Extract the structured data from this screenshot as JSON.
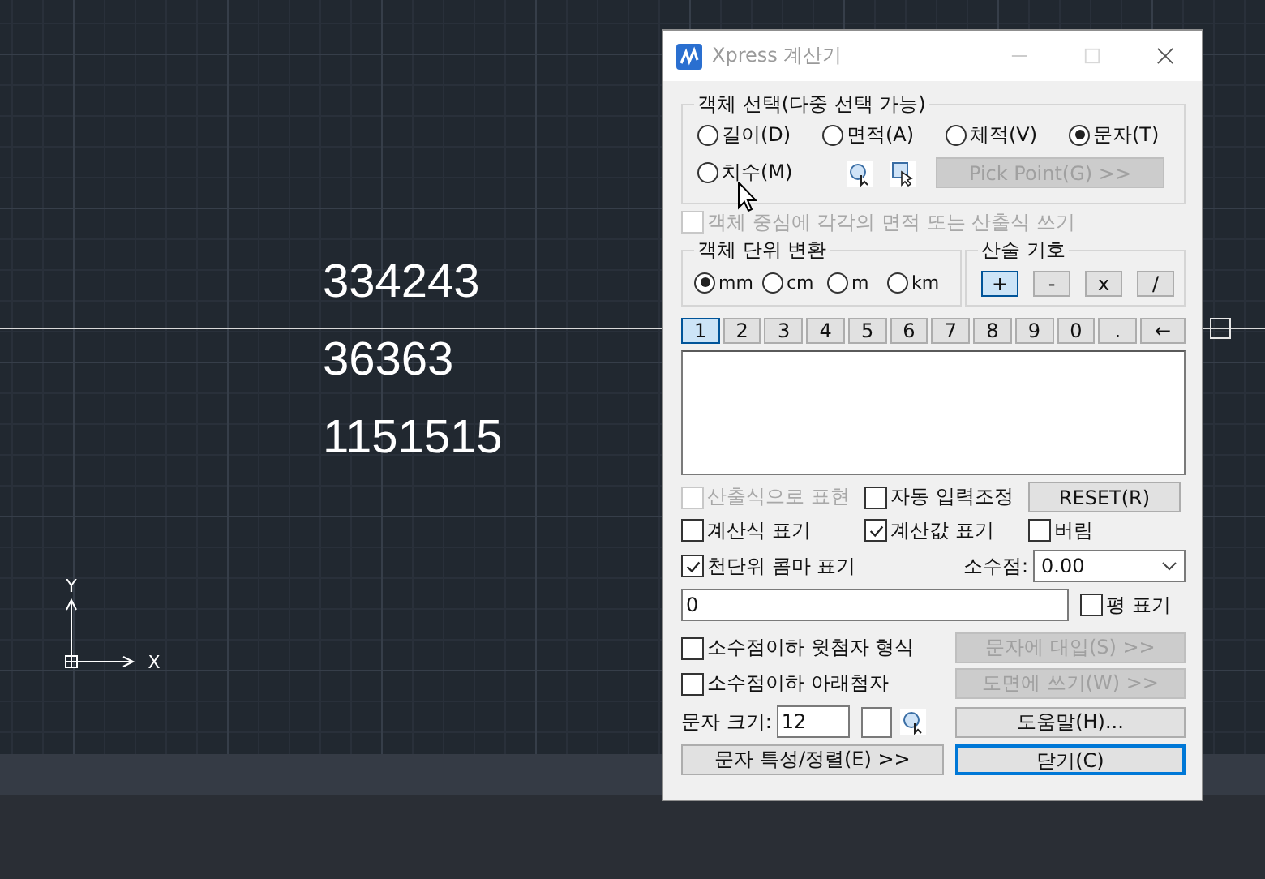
{
  "canvas": {
    "texts": [
      "334243",
      "36363",
      "1151515"
    ],
    "axis_labels": [
      "Y",
      "X"
    ]
  },
  "window": {
    "title": "Xpress 계산기"
  },
  "object_selection": {
    "title": "객체 선택(다중 선택 가능)",
    "options": [
      {
        "label": "길이(D)",
        "selected": false
      },
      {
        "label": "면적(A)",
        "selected": false
      },
      {
        "label": "체적(V)",
        "selected": false
      },
      {
        "label": "문자(T)",
        "selected": true
      },
      {
        "label": "치수(M)",
        "selected": false
      }
    ]
  },
  "unit_conversion": {
    "title": "객체 단위 변환",
    "units": [
      {
        "label": "mm",
        "selected": true
      },
      {
        "label": "cm",
        "selected": false
      },
      {
        "label": "m",
        "selected": false
      },
      {
        "label": "km",
        "selected": false
      }
    ]
  },
  "operators": {
    "title": "산술 기호",
    "buttons": [
      {
        "label": "+",
        "selected": true
      },
      {
        "label": "-",
        "selected": false
      },
      {
        "label": "x",
        "selected": false
      },
      {
        "label": "/",
        "selected": false
      }
    ]
  },
  "keypad": [
    {
      "label": "1",
      "selected": true
    },
    {
      "label": "2",
      "selected": false
    },
    {
      "label": "3",
      "selected": false
    },
    {
      "label": "4",
      "selected": false
    },
    {
      "label": "5",
      "selected": false
    },
    {
      "label": "6",
      "selected": false
    },
    {
      "label": "7",
      "selected": false
    },
    {
      "label": "8",
      "selected": false
    },
    {
      "label": "9",
      "selected": false
    },
    {
      "label": "0",
      "selected": false
    },
    {
      "label": ".",
      "selected": false
    },
    {
      "label": "←",
      "selected": false
    }
  ],
  "checks": [
    {
      "label": "객체 중심에 각각의 면적 또는 산출식 쓰기",
      "checked": false,
      "disabled": true
    },
    {
      "label": "산출식으로 표현",
      "checked": false,
      "disabled": true
    },
    {
      "label": "자동 입력조정",
      "checked": false,
      "disabled": false
    },
    {
      "label": "계산식 표기",
      "checked": false,
      "disabled": false
    },
    {
      "label": "계산값 표기",
      "checked": true,
      "disabled": false
    },
    {
      "label": "버림",
      "checked": false,
      "disabled": false
    },
    {
      "label": "천단위 콤마 표기",
      "checked": true,
      "disabled": false
    },
    {
      "label": "평 표기",
      "checked": false,
      "disabled": false
    },
    {
      "label": "소수점이하 윗첨자 형식",
      "checked": false,
      "disabled": false
    },
    {
      "label": "소수점이하 아래첨자",
      "checked": false,
      "disabled": false
    }
  ],
  "decimal": {
    "label": "소수점:",
    "value": "0.00"
  },
  "result": {
    "value": "0"
  },
  "text_size": {
    "label": "문자 크기:",
    "value": "12"
  },
  "buttons": [
    {
      "label": "Pick Point(G) >>",
      "disabled": true,
      "default": false
    },
    {
      "label": "RESET(R)",
      "disabled": false,
      "default": false
    },
    {
      "label": "문자에 대입(S) >>",
      "disabled": true,
      "default": false
    },
    {
      "label": "도면에 쓰기(W) >>",
      "disabled": true,
      "default": false
    },
    {
      "label": "도움말(H)...",
      "disabled": false,
      "default": false
    },
    {
      "label": "문자 특성/정렬(E) >>",
      "disabled": false,
      "default": false
    },
    {
      "label": "닫기(C)",
      "disabled": false,
      "default": true
    }
  ]
}
